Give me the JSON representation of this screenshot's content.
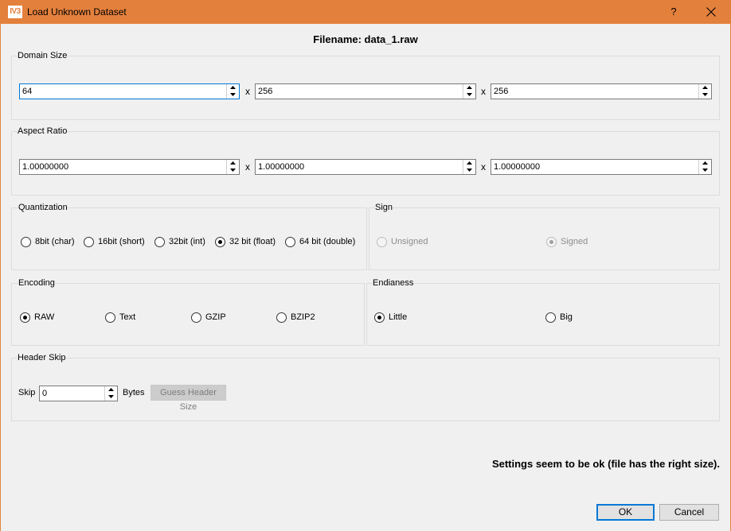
{
  "window": {
    "title": "Load Unknown Dataset",
    "app_icon_text": "IV3",
    "help_label": "?",
    "accent": "#e3803c"
  },
  "filename_label": "Filename: data_1.raw",
  "domain_size": {
    "title": "Domain Size",
    "separator": "x",
    "values": [
      "64",
      "256",
      "256"
    ]
  },
  "aspect_ratio": {
    "title": "Aspect Ratio",
    "separator": "x",
    "values": [
      "1.00000000",
      "1.00000000",
      "1.00000000"
    ]
  },
  "quantization": {
    "title": "Quantization",
    "options": [
      "8bit (char)",
      "16bit (short)",
      "32bit (int)",
      "32 bit (float)",
      "64 bit (double)"
    ],
    "selected": "32 bit (float)"
  },
  "sign": {
    "title": "Sign",
    "options": [
      "Unsigned",
      "Signed"
    ],
    "selected": "Signed",
    "disabled": true
  },
  "encoding": {
    "title": "Encoding",
    "options": [
      "RAW",
      "Text",
      "GZIP",
      "BZIP2"
    ],
    "selected": "RAW"
  },
  "endianess": {
    "title": "Endianess",
    "options": [
      "Little",
      "Big"
    ],
    "selected": "Little"
  },
  "header_skip": {
    "title": "Header Skip",
    "skip_label": "Skip",
    "skip_value": "0",
    "unit_label": "Bytes",
    "guess_button": "Guess Header Size"
  },
  "status_message": "Settings seem to be ok (file has the right size).",
  "buttons": {
    "ok": "OK",
    "cancel": "Cancel"
  }
}
